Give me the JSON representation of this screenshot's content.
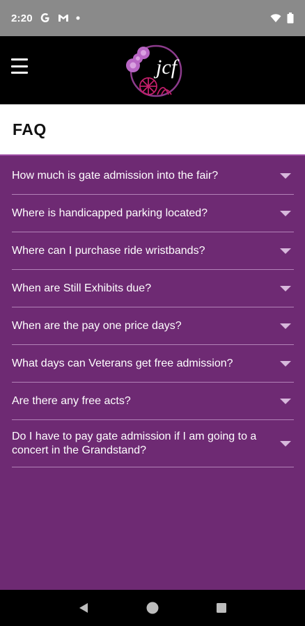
{
  "status": {
    "time": "2:20"
  },
  "page": {
    "title": "FAQ"
  },
  "faq": [
    {
      "question": "How much is gate admission into the fair?"
    },
    {
      "question": "Where is handicapped parking located?"
    },
    {
      "question": "Where can I purchase ride wristbands?"
    },
    {
      "question": "When are Still Exhibits due?"
    },
    {
      "question": "When are the pay one price days?"
    },
    {
      "question": "What days can Veterans get free admission?"
    },
    {
      "question": "Are there any free acts?"
    },
    {
      "question": "Do I have to pay gate admission if I am going to a concert in the Grandstand?"
    }
  ],
  "logo": {
    "text": "jcf"
  },
  "colors": {
    "background": "#6e2a73",
    "app_bar": "#000000",
    "accent_line": "#9c4aa3",
    "chevron": "#d7b8dc"
  }
}
